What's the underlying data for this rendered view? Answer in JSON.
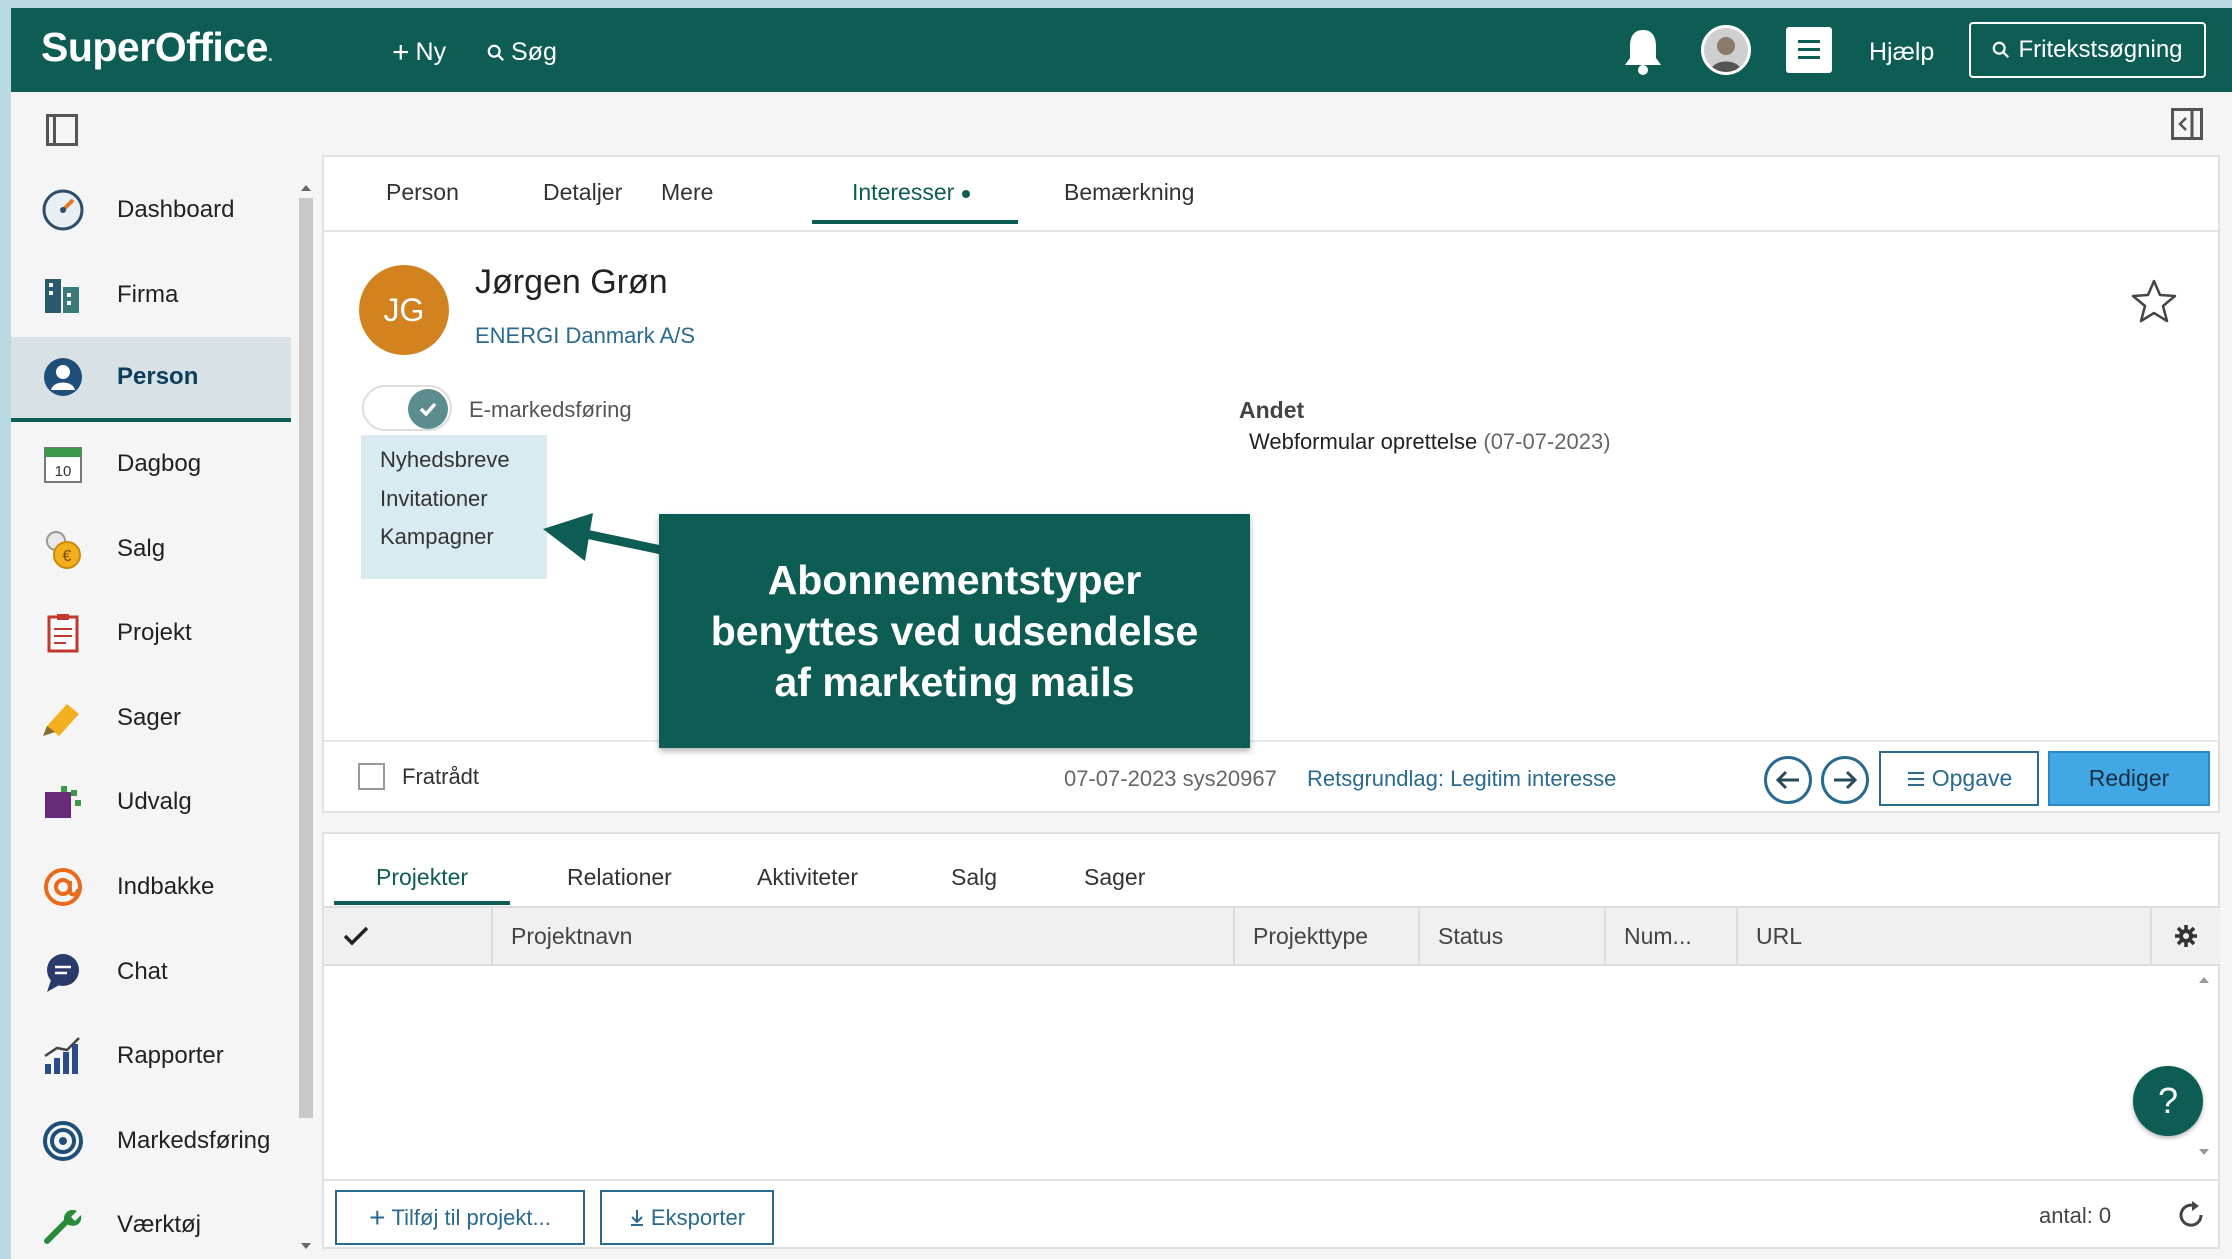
{
  "app": {
    "logo": "SuperOffice",
    "logo_dot": "."
  },
  "topbar": {
    "new_label": "Ny",
    "search_label": "Søg",
    "help_label": "Hjælp",
    "fulltext_label": "Fritekstsøgning"
  },
  "sidebar": {
    "items": [
      {
        "label": "Dashboard",
        "icon": "dashboard-icon"
      },
      {
        "label": "Firma",
        "icon": "company-icon"
      },
      {
        "label": "Person",
        "icon": "person-icon"
      },
      {
        "label": "Dagbog",
        "icon": "calendar-icon",
        "badge": "10"
      },
      {
        "label": "Salg",
        "icon": "sale-icon"
      },
      {
        "label": "Projekt",
        "icon": "project-icon"
      },
      {
        "label": "Sager",
        "icon": "ticket-icon"
      },
      {
        "label": "Udvalg",
        "icon": "selection-icon"
      },
      {
        "label": "Indbakke",
        "icon": "inbox-icon"
      },
      {
        "label": "Chat",
        "icon": "chat-icon"
      },
      {
        "label": "Rapporter",
        "icon": "reports-icon"
      },
      {
        "label": "Markedsføring",
        "icon": "marketing-icon"
      },
      {
        "label": "Værktøj",
        "icon": "tools-icon"
      }
    ],
    "active": "Person"
  },
  "person_card": {
    "tabs": [
      "Person",
      "Detaljer",
      "Mere",
      "Interesser",
      "Bemærkning"
    ],
    "active_tab": "Interesser",
    "initials": "JG",
    "name": "Jørgen Grøn",
    "company": "ENERGI Danmark A/S",
    "emarketing_label": "E-markedsføring",
    "emarketing_on": true,
    "subscriptions": [
      "Nyhedsbreve",
      "Invitationer",
      "Kampagner"
    ],
    "andet_heading": "Andet",
    "andet_value": "Webformular oprettelse",
    "andet_date": "(07-07-2023)",
    "footer": {
      "retired_label": "Fratrådt",
      "meta": "07-07-2023 sys20967",
      "legal": "Retsgrundlag: Legitim interesse",
      "task_label": "Opgave",
      "edit_label": "Rediger"
    }
  },
  "callout": {
    "lines": [
      "Abonnementstyper",
      "benyttes ved udsendelse",
      "af marketing mails"
    ]
  },
  "project_card": {
    "tabs": [
      "Projekter",
      "Relationer",
      "Aktiviteter",
      "Salg",
      "Sager"
    ],
    "active_tab": "Projekter",
    "columns": [
      "Projektnavn",
      "Projekttype",
      "Status",
      "Num...",
      "URL"
    ],
    "rows": [],
    "add_label": "Tilføj til projekt...",
    "export_label": "Eksporter",
    "count_label": "antal: 0"
  },
  "help_fab": "?",
  "colors": {
    "brand": "#0e5d54",
    "accent": "#41a8e3",
    "avatar": "#d2831f",
    "link": "#2a6a8e"
  }
}
